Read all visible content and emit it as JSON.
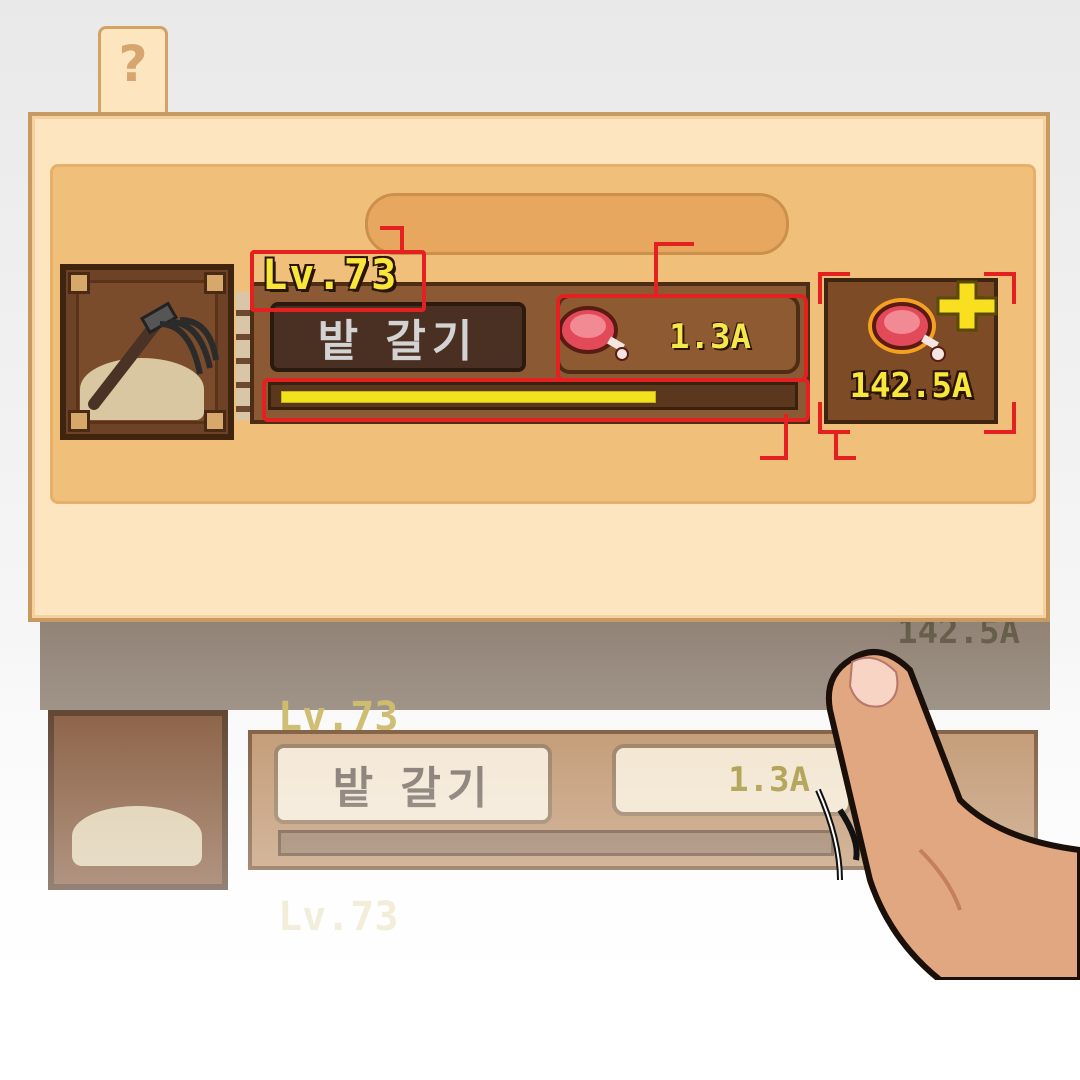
{
  "help_tab": {
    "label": "?"
  },
  "item": {
    "level": "Lv.73",
    "name": "밭 갈기",
    "cost": "1.3A",
    "reward": "142.5A",
    "progress": 0.74
  },
  "ghost_rows": [
    {
      "level": "",
      "name": "",
      "cost": "",
      "reward": "142.5A"
    },
    {
      "level": "Lv.73",
      "name": "밭 갈기",
      "cost": "1.3A",
      "reward": ""
    },
    {
      "level": "Lv.73",
      "name": "",
      "cost": "",
      "reward": ""
    }
  ],
  "colors": {
    "panel": "#fde6bf",
    "inner": "#f0c07a",
    "accent_yellow": "#f8e63a",
    "highlight_red": "#e42020",
    "wood_dark": "#4d2d14"
  },
  "icons": [
    "help-icon",
    "hoe-rake-icon",
    "meat-icon",
    "plus-icon",
    "pointing-finger-icon"
  ]
}
